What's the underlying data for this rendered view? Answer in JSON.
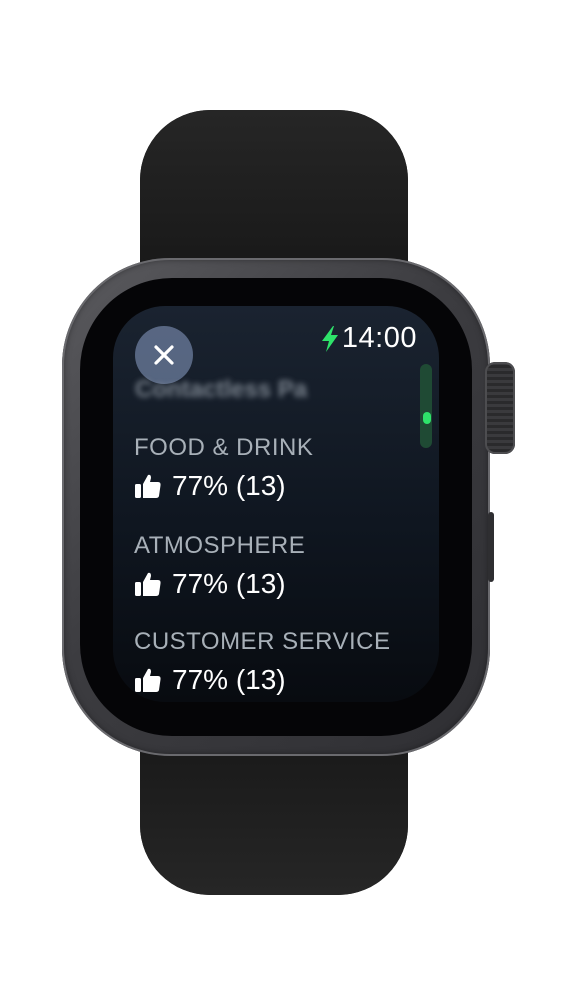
{
  "watch": {
    "time": "14:00",
    "close_icon": "close-icon",
    "charging_icon": "lightning-bolt-icon",
    "blurred_header": "Contactless Pa",
    "colors": {
      "accent_green": "#2EE36A",
      "screen_bg": "#0F1620",
      "label_gray": "#A8B0B8"
    }
  },
  "ratings": [
    {
      "label": "FOOD & DRINK",
      "icon": "thumbs-up-icon",
      "value": "77% (13)"
    },
    {
      "label": "ATMOSPHERE",
      "icon": "thumbs-up-icon",
      "value": "77% (13)"
    },
    {
      "label": "CUSTOMER SERVICE",
      "icon": "thumbs-up-icon",
      "value": "77% (13)"
    }
  ]
}
